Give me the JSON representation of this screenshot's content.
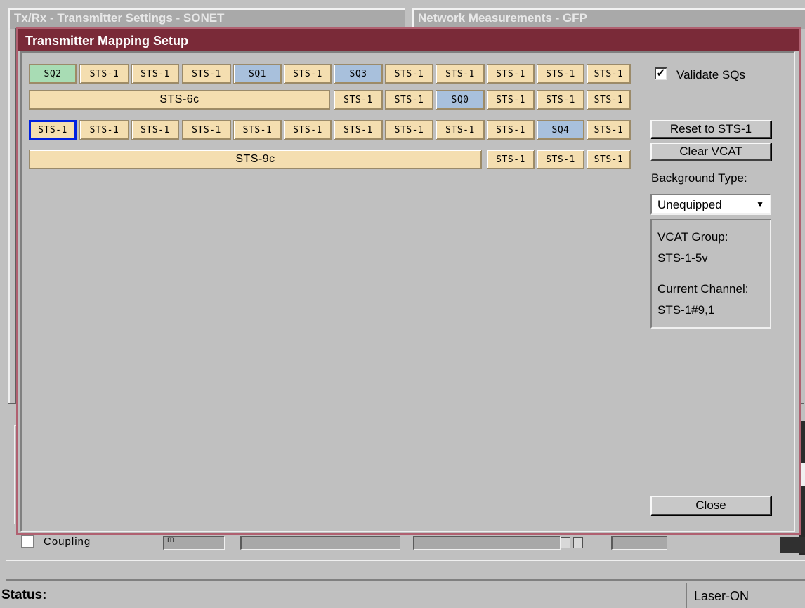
{
  "background": {
    "tab1_title": "Tx/Rx - Transmitter Settings - SONET",
    "tab2_title": "Network Measurements - GFP",
    "coupling_label": "Coupling",
    "widget_glyph": "m",
    "status_label": "Status:",
    "laser_status": "Laser-ON"
  },
  "dialog": {
    "title": "Transmitter Mapping Setup",
    "grid": {
      "rows": [
        [
          "SQ2",
          "STS-1",
          "STS-1",
          "STS-1",
          "SQ1",
          "STS-1",
          "SQ3",
          "STS-1",
          "STS-1",
          "STS-1",
          "STS-1",
          "STS-1"
        ],
        [
          "STS-6c",
          "STS-1",
          "STS-1",
          "SQ0",
          "STS-1",
          "STS-1",
          "STS-1"
        ],
        [
          "STS-1",
          "STS-1",
          "STS-1",
          "STS-1",
          "STS-1",
          "STS-1",
          "STS-1",
          "STS-1",
          "STS-1",
          "STS-1",
          "SQ4",
          "STS-1"
        ],
        [
          "STS-9c",
          "STS-1",
          "STS-1",
          "STS-1"
        ]
      ],
      "selected_cell": "STS-1 (row 3, column 1)"
    },
    "validate_label": "Validate SQs",
    "validate_checked": true,
    "check_mark": "✓",
    "reset_button": "Reset to STS-1",
    "clear_button": "Clear VCAT",
    "background_type_label": "Background Type:",
    "background_type_value": "Unequipped",
    "dropdown_arrow": "▼",
    "vcat_group_label": "VCAT Group:",
    "vcat_group_value": "STS-1-5v",
    "current_channel_label": "Current Channel:",
    "current_channel_value": "STS-1#9,1",
    "close_button": "Close"
  },
  "colors": {
    "title_bar": "#7a2a38",
    "sts_cell": "#f4deb0",
    "sq_green": "#a8dcb4",
    "sq_blue": "#a8c0dc",
    "selected_border": "#0020e0"
  }
}
